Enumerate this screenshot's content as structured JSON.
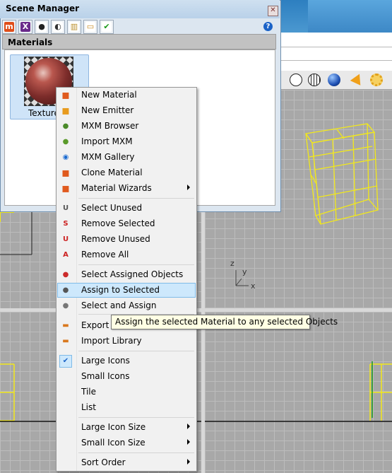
{
  "scene_manager": {
    "title": "Scene Manager",
    "close_glyph": "✕",
    "help_glyph": "?",
    "tabs": [
      {
        "name": "materials-tab",
        "glyph": "m",
        "color": "#e04e1a",
        "text_color": "#ffffff"
      },
      {
        "name": "emitters-tab",
        "glyph": "X",
        "color": "#6a2a8a",
        "text_color": "#ffffff"
      },
      {
        "name": "camera-tab",
        "glyph": "●",
        "color": "#ffffff",
        "text_color": "#222222"
      },
      {
        "name": "environment-tab",
        "glyph": "◐",
        "color": "#ffffff",
        "text_color": "#333333"
      },
      {
        "name": "render-tab",
        "glyph": "▥",
        "color": "#ffffff",
        "text_color": "#b98d2a"
      },
      {
        "name": "folder-tab",
        "glyph": "▭",
        "color": "#ffffff",
        "text_color": "#c98a20"
      },
      {
        "name": "check-tab",
        "glyph": "✔",
        "color": "#ffffff",
        "text_color": "#1a9a1a"
      }
    ],
    "section_label": "Materials",
    "material": {
      "label": "Textured"
    }
  },
  "context_menu": {
    "items": [
      {
        "id": "new-material",
        "label": "New Material",
        "icon": "new-material-icon",
        "glyph": "▪",
        "icon_color": "#e05a1e"
      },
      {
        "id": "new-emitter",
        "label": "New Emitter",
        "icon": "new-emitter-icon",
        "glyph": "▪",
        "icon_color": "#e89b1e"
      },
      {
        "id": "mxm-browser",
        "label": "MXM Browser",
        "icon": "mxm-browser-icon",
        "glyph": "●",
        "icon_color": "#4a8a2a"
      },
      {
        "id": "import-mxm",
        "label": "Import MXM",
        "icon": "import-mxm-icon",
        "glyph": "●",
        "icon_color": "#5a9a2a"
      },
      {
        "id": "mxm-gallery",
        "label": "MXM Gallery",
        "icon": "mxm-gallery-icon",
        "glyph": "◉",
        "icon_color": "#1a6ad0"
      },
      {
        "id": "clone-material",
        "label": "Clone Material",
        "icon": "clone-material-icon",
        "glyph": "▪",
        "icon_color": "#e05a1e"
      },
      {
        "id": "material-wizards",
        "label": "Material Wizards",
        "icon": "material-wizards-icon",
        "glyph": "▪",
        "icon_color": "#e05a1e",
        "submenu": true
      },
      {
        "id": "select-unused",
        "label": "Select Unused",
        "icon": "select-unused-icon",
        "glyph": "U",
        "icon_color": "#555555"
      },
      {
        "id": "remove-selected",
        "label": "Remove Selected",
        "icon": "remove-selected-icon",
        "glyph": "S",
        "icon_color": "#cc2222"
      },
      {
        "id": "remove-unused",
        "label": "Remove Unused",
        "icon": "remove-unused-icon",
        "glyph": "U",
        "icon_color": "#cc2222"
      },
      {
        "id": "remove-all",
        "label": "Remove All",
        "icon": "remove-all-icon",
        "glyph": "A",
        "icon_color": "#cc2222"
      },
      {
        "id": "select-assigned",
        "label": "Select Assigned Objects",
        "icon": "select-assigned-icon",
        "glyph": "●",
        "icon_color": "#cc2b2b"
      },
      {
        "id": "assign-selected",
        "label": "Assign to Selected",
        "icon": "assign-selected-icon",
        "glyph": "●",
        "icon_color": "#555555",
        "highlighted": true
      },
      {
        "id": "select-and-assign",
        "label": "Select and Assign",
        "icon": "select-and-assign-icon",
        "glyph": "●",
        "icon_color": "#777777"
      },
      {
        "id": "export-s",
        "label": "Export S",
        "icon": "export-icon",
        "glyph": "▬",
        "icon_color": "#d9781e"
      },
      {
        "id": "import-library",
        "label": "Import Library",
        "icon": "import-library-icon",
        "glyph": "▬",
        "icon_color": "#d9781e"
      },
      {
        "id": "large-icons",
        "label": "Large Icons",
        "icon": "checkmark-icon",
        "glyph": "✔",
        "icon_color": "#1a62c7",
        "checked": true
      },
      {
        "id": "small-icons",
        "label": "Small Icons"
      },
      {
        "id": "tile",
        "label": "Tile"
      },
      {
        "id": "list",
        "label": "List"
      },
      {
        "id": "large-icon-size",
        "label": "Large Icon Size",
        "submenu": true
      },
      {
        "id": "small-icon-size",
        "label": "Small Icon Size",
        "submenu": true
      },
      {
        "id": "sort-order",
        "label": "Sort Order",
        "submenu": true
      }
    ]
  },
  "tooltip": {
    "text": "Assign the selected Material to any selected Objects"
  },
  "viewport": {
    "axis_y": "y",
    "axis_x": "x",
    "axis_z": "z",
    "box_color": "#f2e81a"
  },
  "colors": {
    "highlight": "#cde8fc",
    "window_title": "#b9d1e9"
  }
}
